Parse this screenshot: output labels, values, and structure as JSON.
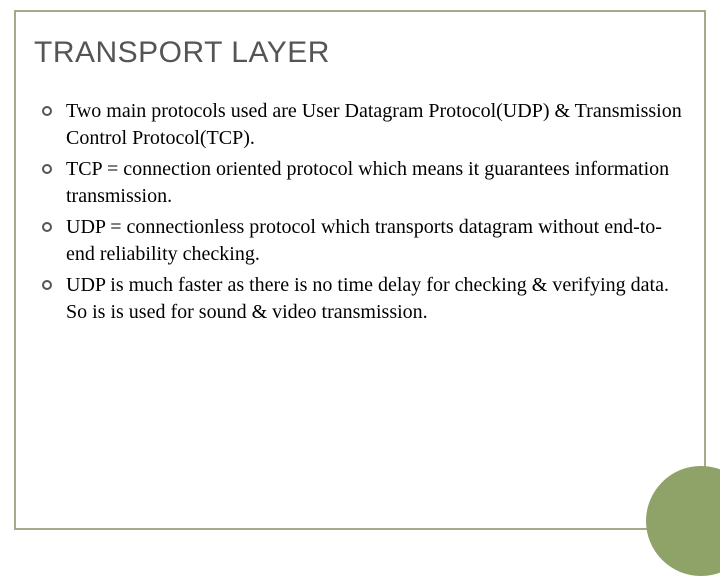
{
  "slide": {
    "title": "TRANSPORT LAYER",
    "bullets": [
      "Two main protocols used are User Datagram Protocol(UDP) & Transmission Control Protocol(TCP).",
      "TCP = connection oriented protocol which means it guarantees information transmission.",
      "UDP = connectionless protocol which transports datagram without end-to-end reliability checking.",
      "UDP is much faster as there is no time delay for checking & verifying data. So is is used for sound & video transmission."
    ]
  },
  "colors": {
    "border": "#a8a88a",
    "accent_circle": "#8fa268",
    "title_text": "#555555",
    "body_text": "#000000"
  }
}
